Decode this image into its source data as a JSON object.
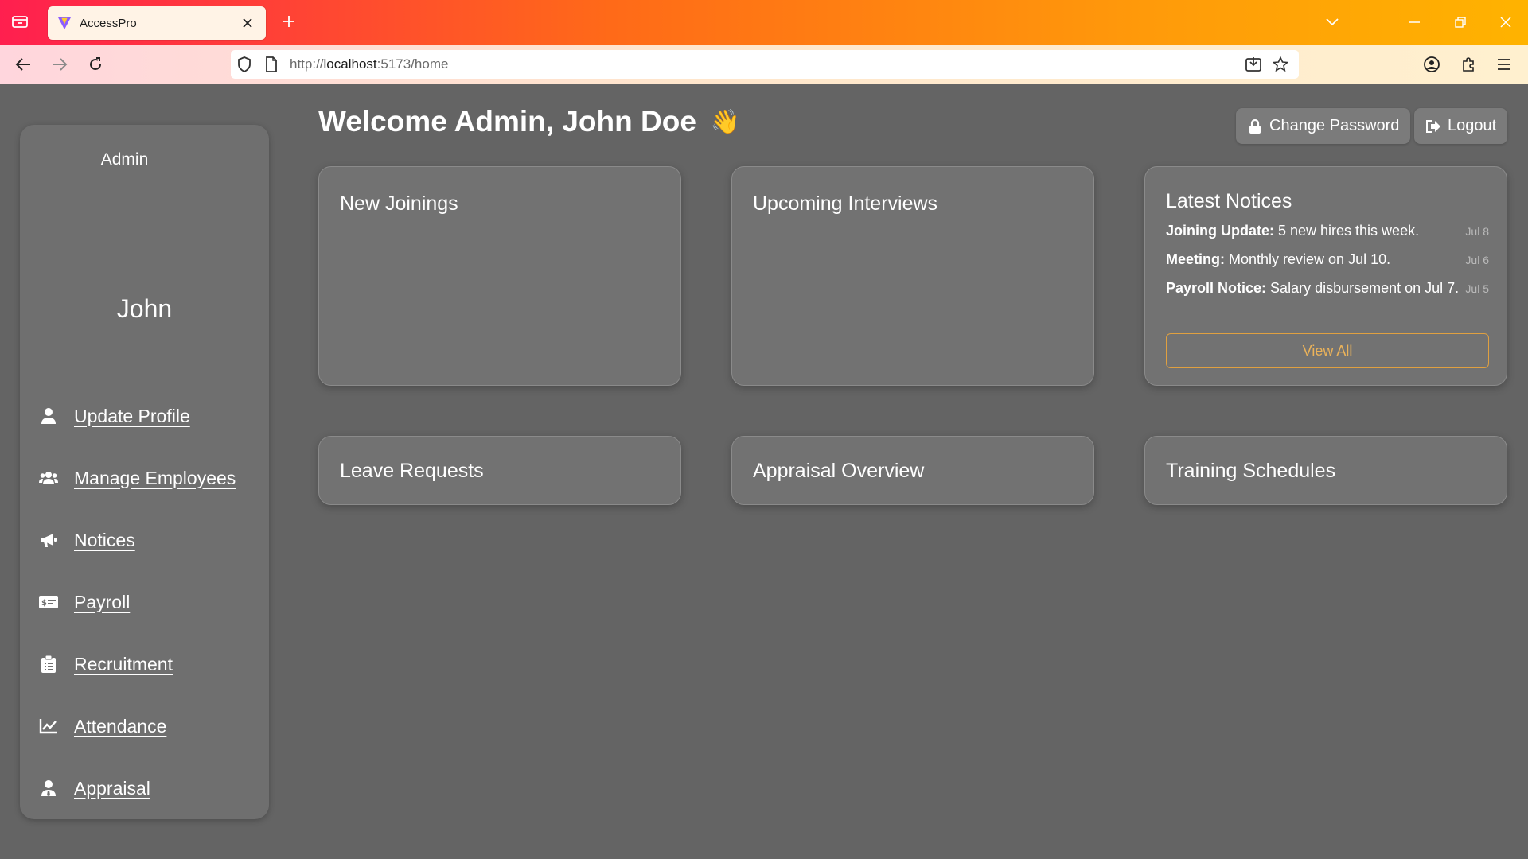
{
  "browser": {
    "tab_title": "AccessPro",
    "url_prefix": "http://",
    "url_host": "localhost",
    "url_rest": ":5173/home"
  },
  "header": {
    "welcome": "Welcome Admin, John Doe",
    "wave_emoji": "👋",
    "change_password": "Change Password",
    "logout": "Logout"
  },
  "sidebar": {
    "role": "Admin",
    "name": "John",
    "items": [
      {
        "label": "Update Profile",
        "icon": "user-icon"
      },
      {
        "label": "Manage Employees",
        "icon": "users-icon"
      },
      {
        "label": "Notices",
        "icon": "bullhorn-icon"
      },
      {
        "label": "Payroll",
        "icon": "money-check-icon"
      },
      {
        "label": "Recruitment",
        "icon": "clipboard-icon"
      },
      {
        "label": "Attendance",
        "icon": "chart-line-icon"
      },
      {
        "label": "Appraisal",
        "icon": "user-tie-icon"
      }
    ]
  },
  "cards": {
    "new_joinings": "New Joinings",
    "upcoming_interviews": "Upcoming Interviews",
    "latest_notices": "Latest Notices",
    "leave_requests": "Leave Requests",
    "appraisal_overview": "Appraisal Overview",
    "training_schedules": "Training Schedules"
  },
  "notices": [
    {
      "title": "Joining Update:",
      "text": " 5 new hires this week.",
      "date": "Jul 8"
    },
    {
      "title": "Meeting:",
      "text": " Monthly review on Jul 10.",
      "date": "Jul 6"
    },
    {
      "title": "Payroll Notice:",
      "text": " Salary disbursement on Jul 7.",
      "date": "Jul 5"
    }
  ],
  "view_all": "View All",
  "colors": {
    "page_bg": "#646464",
    "card_bg": "#727272",
    "accent": "#eab25a"
  }
}
